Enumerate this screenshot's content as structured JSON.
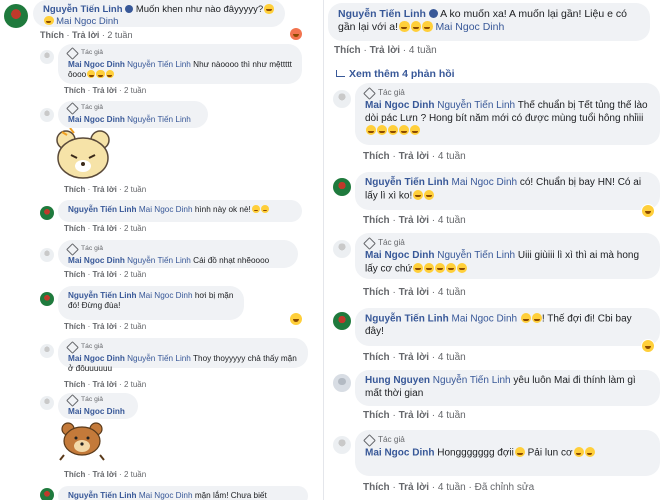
{
  "left": {
    "top_comment": {
      "author": "Nguyễn Tiến Linh",
      "text": "Muốn khen như nào đâyyyyy?",
      "tag": "Mai Ngoc Dinh",
      "actions": [
        "Thích",
        "Trả lời",
        "2 tuần"
      ]
    },
    "replies": [
      {
        "badge": "Tác giả",
        "author": "Mai Ngoc Dinh",
        "tag": "Nguyễn Tiến Linh",
        "text": "Như nàoooo thì như mệttttt ôooo",
        "actions": [
          "Thích",
          "Trả lời",
          "2 tuần"
        ]
      },
      {
        "badge": "Tác giả",
        "author": "Mai Ngoc Dinh",
        "tag": "Nguyễn Tiến Linh",
        "text": "",
        "actions": [
          "Thích",
          "Trả lời",
          "2 tuần"
        ]
      },
      {
        "author": "Nguyễn Tiến Linh",
        "tag": "Mai Ngoc Dinh",
        "text": "hình này ok nè!",
        "actions": [
          "Thích",
          "Trả lời",
          "2 tuần"
        ]
      },
      {
        "badge": "Tác giả",
        "author": "Mai Ngoc Dinh",
        "tag": "Nguyễn Tiến Linh",
        "text": "Cái đồ nhạt nhẽoooo",
        "actions": [
          "Thích",
          "Trả lời",
          "2 tuần"
        ]
      },
      {
        "author": "Nguyễn Tiến Linh",
        "tag": "Mai Ngoc Dinh",
        "text": "hơi bị mặn đó! Đừng đùa!",
        "actions": [
          "Thích",
          "Trả lời",
          "2 tuần"
        ]
      },
      {
        "badge": "Tác giả",
        "author": "Mai Ngoc Dinh",
        "tag": "Nguyễn Tiến Linh",
        "text": "Thoy thoyyyyy chả thấy mặn ở đôuuuuuu",
        "actions": [
          "Thích",
          "Trả lời",
          "2 tuần"
        ]
      },
      {
        "badge": "Tác giả",
        "author": "Mai Ngoc Dinh",
        "tag": "",
        "text": "",
        "actions": [
          "Thích",
          "Trả lời",
          "2 tuần"
        ]
      },
      {
        "author": "Nguyễn Tiến Linh",
        "tag": "Mai Ngoc Dinh",
        "text": "mặn lắm! Chưa biết",
        "actions": []
      }
    ]
  },
  "right": {
    "top_comment": {
      "author": "Nguyễn Tiến Linh",
      "text": "A ko muốn xa! A muốn lại gần! Liệu e có gần lại với a!",
      "tag": "Mai Ngoc Dinh",
      "actions": [
        "Thích",
        "Trả lời",
        "4 tuần"
      ]
    },
    "see_more": "Xem thêm 4 phản hồi",
    "replies": [
      {
        "badge": "Tác giả",
        "author": "Mai Ngoc Dinh",
        "tag": "Nguyễn Tiến Linh",
        "text": "Thế chuẩn bị Tết tủng thế lào dòi pác Lưn ? Hong bít năm mới có được mùng tuổi hông nhỉiii",
        "actions": [
          "Thích",
          "Trả lời",
          "4 tuần"
        ]
      },
      {
        "author": "Nguyễn Tiến Linh",
        "tag": "Mai Ngoc Dinh",
        "text": "có! Chuẩn bị bay HN! Có ai lấy lì xì ko!",
        "actions": [
          "Thích",
          "Trả lời",
          "4 tuần"
        ]
      },
      {
        "badge": "Tác giả",
        "author": "Mai Ngoc Dinh",
        "tag": "Nguyễn Tiến Linh",
        "text": "Uiii giùiii lì xì thì ai mà hong lấy cơ chứ",
        "actions": [
          "Thích",
          "Trả lời",
          "4 tuần"
        ]
      },
      {
        "author": "Nguyễn Tiến Linh",
        "tag": "Mai Ngoc Dinh",
        "text": "! Thế đợi đi! Cbi bay đây!",
        "actions": [
          "Thích",
          "Trả lời",
          "4 tuần"
        ]
      },
      {
        "author": "Hung Nguyen",
        "tag": "Nguyễn Tiến Linh",
        "text": "yêu luôn Mai đi thính làm gì mất thời gian",
        "actions": [
          "Thích",
          "Trả lời",
          "4 tuần"
        ]
      },
      {
        "badge": "Tác giả",
        "author": "Mai Ngoc Dinh",
        "tag": "",
        "text": "Honggggggg đợii",
        "text2": "Pải lun cơ",
        "actions": [
          "Thích",
          "Trả lời",
          "4 tuần",
          "Đã chỉnh sửa"
        ]
      }
    ]
  }
}
